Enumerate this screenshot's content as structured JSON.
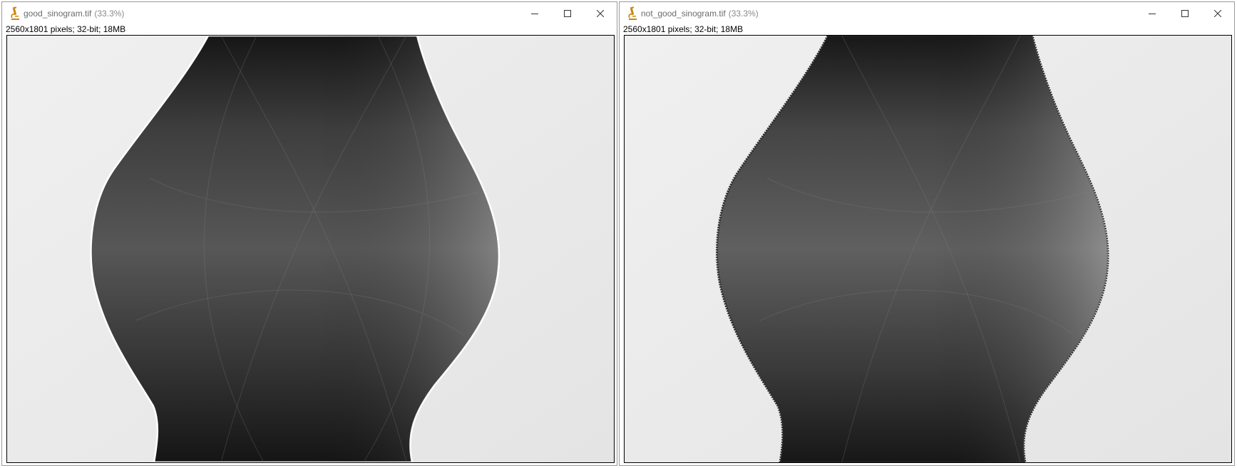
{
  "windows": [
    {
      "title": "good_sinogram.tif",
      "zoom": "(33.3%)",
      "info": "2560x1801 pixels; 32-bit; 18MB",
      "icons": {
        "app": "imagej-microscope-icon",
        "minimize": "minimize-icon",
        "maximize": "maximize-icon",
        "close": "close-icon"
      }
    },
    {
      "title": "not_good_sinogram.tif",
      "zoom": "(33.3%)",
      "info": "2560x1801 pixels; 32-bit; 18MB",
      "icons": {
        "app": "imagej-microscope-icon",
        "minimize": "minimize-icon",
        "maximize": "maximize-icon",
        "close": "close-icon"
      }
    }
  ],
  "colors": {
    "title_text": "#6b6b6b",
    "background_gray": "#ebebeb",
    "sinogram_dark": "#161616",
    "sinogram_mid": "#5a5a5a",
    "sinogram_light": "#8c8c8c",
    "accent_icon": "#c9870a"
  }
}
